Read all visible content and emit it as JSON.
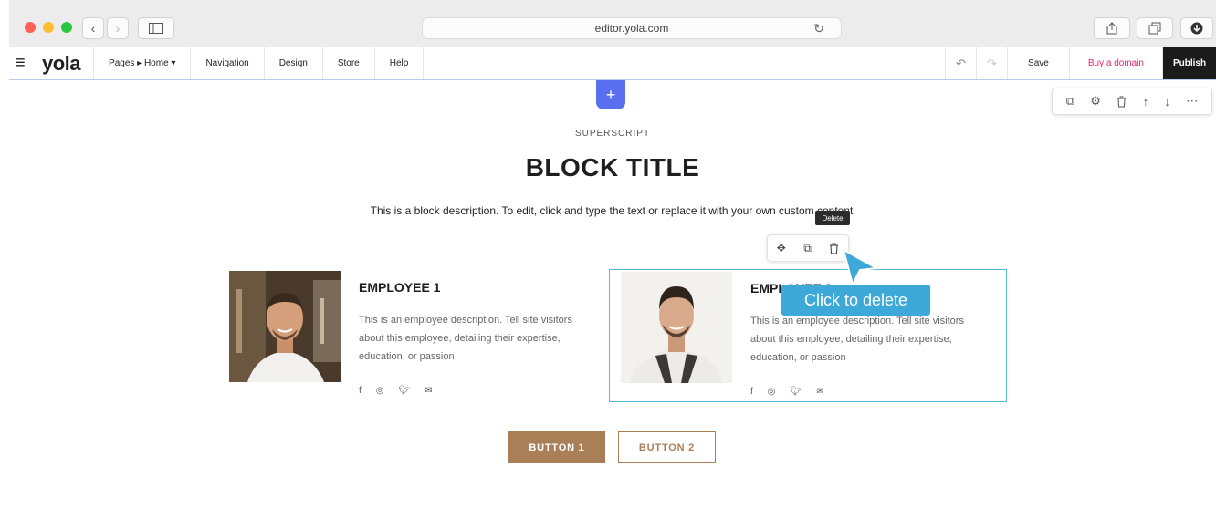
{
  "browser": {
    "url": "editor.yola.com"
  },
  "toolbar": {
    "logo": "yola",
    "pages_label": "Pages ▸ Home ▾",
    "navigation_label": "Navigation",
    "design_label": "Design",
    "store_label": "Store",
    "help_label": "Help",
    "save_label": "Save",
    "buy_domain_label": "Buy a domain",
    "publish_label": "Publish"
  },
  "block": {
    "superscript": "SUPERSCRIPT",
    "title": "BLOCK TITLE",
    "description": "This is a block description. To edit, click and type the text or replace it with your own custom content"
  },
  "employees": [
    {
      "name": "EMPLOYEE 1",
      "description": "This is an employee description. Tell site visitors about this employee, detailing their expertise, education, or passion"
    },
    {
      "name": "EMPLOYEE 2",
      "description": "This is an employee description. Tell site visitors about this employee, detailing their expertise, education, or passion"
    }
  ],
  "tooltip": {
    "delete": "Delete",
    "callout": "Click to delete"
  },
  "buttons": {
    "button1": "BUTTON 1",
    "button2": "BUTTON 2"
  },
  "colors": {
    "accent_button": "#a97f57",
    "selection_border": "#55b7d9",
    "callout": "#3da9d8",
    "add_button": "#5a6ff0",
    "buy_domain": "#e8236c"
  }
}
